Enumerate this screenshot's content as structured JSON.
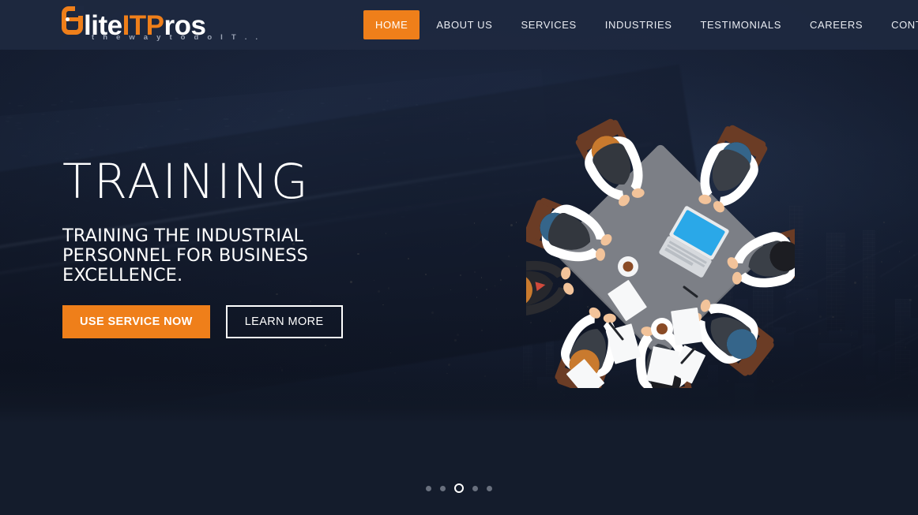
{
  "site": {
    "logo": {
      "mark_letter": "e",
      "part_white_1": "lite",
      "part_orange": "ITP",
      "part_white_2": "ros",
      "tagline": "t h e   w a y   t o   d o   I T . ."
    },
    "brand_orange": "#ef7f1a",
    "header_bg": "#1e2940",
    "page_bg": "#141c2c"
  },
  "nav": {
    "items": [
      {
        "label": "HOME",
        "active": true
      },
      {
        "label": "ABOUT US",
        "active": false
      },
      {
        "label": "SERVICES",
        "active": false
      },
      {
        "label": "INDUSTRIES",
        "active": false
      },
      {
        "label": "TESTIMONIALS",
        "active": false
      },
      {
        "label": "CAREERS",
        "active": false
      },
      {
        "label": "CONTACT",
        "active": false
      }
    ]
  },
  "hero": {
    "title": "TRAINING",
    "subtitle": "TRAINING THE INDUSTRIAL PERSONNEL FOR BUSINESS EXCELLENCE.",
    "primary_button": "USE SERVICE NOW",
    "secondary_button": "LEARN MORE",
    "illustration": "business-meeting-top-view-illustration",
    "background": "aerial-city-night-photo"
  },
  "carousel": {
    "slide_count": 5,
    "active_index": 2,
    "dots": [
      "1",
      "2",
      "3",
      "4",
      "5"
    ]
  }
}
